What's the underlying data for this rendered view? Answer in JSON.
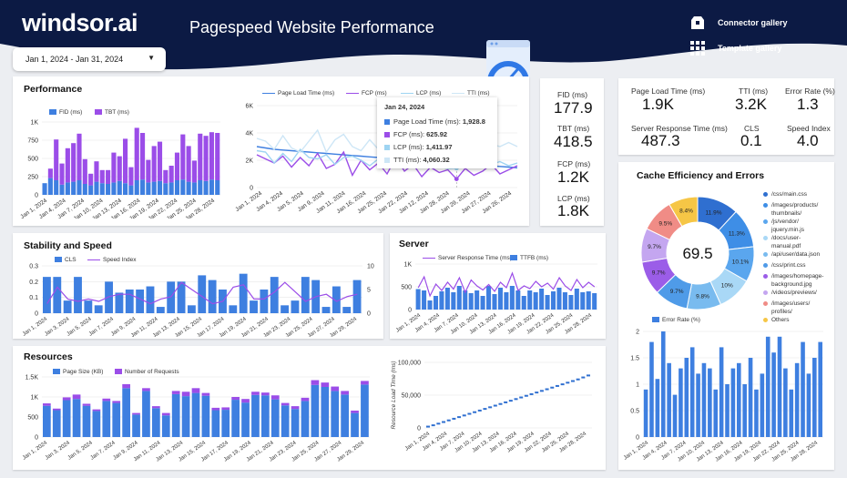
{
  "header": {
    "logo": "windsor.ai",
    "title": "Pagespeed Website Performance",
    "links": [
      {
        "label": "Connector gallery",
        "icon": "connector-icon"
      },
      {
        "label": "Template gallery",
        "icon": "grid-icon"
      }
    ]
  },
  "date_range": "Jan 1, 2024 - Jan 31, 2024",
  "colors": {
    "header": "#0c1a44",
    "blue": "#3e7fe0",
    "purple": "#9b4de8",
    "lightblue": "#9ed4f2",
    "darkblue": "#2f6fd0"
  },
  "scorecards_left": [
    {
      "label": "FID (ms)",
      "value": "177.9"
    },
    {
      "label": "TBT (ms)",
      "value": "418.5"
    },
    {
      "label": "FCP (ms)",
      "value": "1.2K"
    },
    {
      "label": "LCP (ms)",
      "value": "1.8K"
    }
  ],
  "scorecards_top": [
    {
      "label": "Page Load Time (ms)",
      "value": "1.9K"
    },
    {
      "label": "TTI (ms)",
      "value": "3.2K"
    },
    {
      "label": "Error Rate (%)",
      "value": "1.3"
    },
    {
      "label": "Server Response Time (ms)",
      "value": "487.3"
    },
    {
      "label": "CLS",
      "value": "0.1"
    },
    {
      "label": "Speed Index",
      "value": "4.0"
    }
  ],
  "sections": {
    "performance": "Performance",
    "stability": "Stability and Speed",
    "server": "Server",
    "resources": "Resources",
    "cache": "Cache Efficiency and Errors"
  },
  "tooltip": {
    "date": "Jan 24, 2024",
    "rows": [
      {
        "label": "Page Load Time (ms): ",
        "value": "1,928.8"
      },
      {
        "label": "FCP (ms): ",
        "value": "625.92"
      },
      {
        "label": "LCP (ms): ",
        "value": "1,411.97"
      },
      {
        "label": "TTI (ms): ",
        "value": "4,060.32"
      }
    ]
  },
  "chart_data": [
    {
      "id": "perf-bars",
      "type": "bar",
      "series": [
        {
          "name": "FID (ms)",
          "values": [
            160,
            230,
            200,
            140,
            170,
            180,
            200,
            150,
            130,
            180,
            160,
            150,
            170,
            190,
            160,
            130,
            200,
            210,
            170,
            180,
            190,
            160,
            170,
            200,
            210,
            180,
            170,
            200,
            190,
            210,
            200
          ]
        },
        {
          "name": "TBT (ms)",
          "values": [
            0,
            130,
            560,
            290,
            470,
            530,
            640,
            340,
            160,
            280,
            180,
            190,
            410,
            340,
            610,
            250,
            720,
            640,
            310,
            490,
            540,
            180,
            230,
            380,
            620,
            490,
            300,
            640,
            620,
            650,
            650
          ]
        }
      ],
      "x_ticks": [
        "Jan 1, 2024",
        "Jan 4, 2024",
        "Jan 7, 2024",
        "Jan 10, 2024",
        "Jan 13, 2024",
        "Jan 16, 2024",
        "Jan 19, 2024",
        "Jan 22, 2024",
        "Jan 25, 2024",
        "Jan 28, 2024"
      ],
      "y_ticks": [
        "0",
        "250",
        "500",
        "750",
        "1K"
      ],
      "ylim": [
        0,
        1000
      ]
    },
    {
      "id": "perf-lines",
      "type": "line",
      "series": [
        {
          "name": "Page Load Time (ms)",
          "values": [
            3000,
            2900,
            2800,
            2750,
            2700,
            2650,
            2600,
            2550,
            2500,
            2450,
            2400,
            2350,
            2300,
            2250,
            2200,
            2150,
            2100,
            2050,
            2000,
            1950,
            1928,
            1900,
            1850,
            1800,
            1750,
            1700,
            1650,
            1600,
            1550,
            1500,
            1450
          ]
        },
        {
          "name": "FCP (ms)",
          "values": [
            2400,
            2100,
            1800,
            2300,
            1500,
            2200,
            1600,
            2500,
            1400,
            1700,
            2600,
            900,
            2000,
            1300,
            1800,
            1000,
            2200,
            1200,
            1700,
            800,
            1500,
            1100,
            1300,
            626,
            1400,
            900,
            1200,
            1700,
            1000,
            1300,
            1600
          ]
        },
        {
          "name": "LCP (ms)",
          "values": [
            2700,
            2600,
            1800,
            2500,
            1900,
            2800,
            2200,
            2100,
            2400,
            1700,
            2200,
            2300,
            2000,
            1600,
            2100,
            2300,
            1500,
            2000,
            1900,
            1800,
            1700,
            1500,
            1400,
            1412,
            1900,
            1600,
            1800,
            1700,
            1900,
            1600,
            1800
          ]
        },
        {
          "name": "TTI (ms)",
          "values": [
            3600,
            3400,
            2800,
            3800,
            2900,
            2600,
            3400,
            4200,
            2600,
            3500,
            3900,
            3000,
            2700,
            3500,
            2800,
            3700,
            2500,
            3500,
            4300,
            2300,
            3400,
            3600,
            4500,
            4060,
            3200,
            2800,
            3500,
            3200,
            3000,
            3300,
            3000
          ]
        }
      ],
      "x_ticks": [
        "Jan 1, 2024",
        "Jan 4, 2024",
        "Jan 5, 2024",
        "Jan 9, 2024",
        "Jan 11, 2024",
        "Jan 16, 2024",
        "Jan 25, 2024",
        "Jan 22, 2024",
        "Jan 12, 2024",
        "Jan 28, 2024",
        "Jan 29, 2024",
        "Jan 27, 2024",
        "Jan 26, 2024"
      ],
      "y_ticks": [
        "0",
        "2K",
        "4K",
        "6K"
      ],
      "ylim": [
        0,
        6000
      ]
    },
    {
      "id": "stability",
      "type": "bar",
      "series": [
        {
          "name": "CLS",
          "values": [
            0.23,
            0.23,
            0.08,
            0.23,
            0.08,
            0.05,
            0.2,
            0.13,
            0.15,
            0.15,
            0.17,
            0.04,
            0.2,
            0.2,
            0.05,
            0.24,
            0.21,
            0.15,
            0.05,
            0.25,
            0.08,
            0.15,
            0.23,
            0.05,
            0.08,
            0.23,
            0.21,
            0.04,
            0.17,
            0.04,
            0.21
          ]
        },
        {
          "name": "Speed Index",
          "values": [
            2.0,
            5.5,
            3.0,
            2.5,
            3.0,
            2.5,
            3.5,
            4.0,
            4.0,
            3.0,
            2.0,
            3.0,
            3.5,
            6.5,
            5.0,
            3.5,
            2.0,
            2.5,
            5.5,
            6.0,
            3.0,
            3.0,
            4.5,
            6.5,
            4.5,
            2.5,
            3.5,
            4.0,
            2.5,
            3.5,
            4.0
          ]
        }
      ],
      "x_ticks": [
        "Jan 1, 2024",
        "Jan 3, 2024",
        "Jan 5, 2024",
        "Jan 7, 2024",
        "Jan 9, 2024",
        "Jan 11, 2024",
        "Jan 13, 2024",
        "Jan 15, 2024",
        "Jan 17, 2024",
        "Jan 19, 2024",
        "Jan 21, 2024",
        "Jan 23, 2024",
        "Jan 25, 2024",
        "Jan 27, 2024",
        "Jan 29, 2024"
      ],
      "y_ticks": [
        "0",
        "0.1",
        "0.2",
        "0.3"
      ],
      "y2_ticks": [
        "0",
        "5",
        "10"
      ],
      "ylim": [
        0,
        0.3
      ],
      "y2lim": [
        0,
        10
      ]
    },
    {
      "id": "server",
      "type": "bar",
      "series": [
        {
          "name": "Server Response Time (ms)",
          "values": [
            480,
            720,
            300,
            560,
            420,
            600,
            450,
            700,
            380,
            650,
            520,
            430,
            550,
            400,
            600,
            480,
            800,
            420,
            520,
            460,
            620,
            500,
            580,
            450,
            700,
            520,
            420,
            660,
            480,
            600,
            500
          ]
        },
        {
          "name": "TTFB (ms)",
          "values": [
            450,
            420,
            200,
            300,
            400,
            480,
            380,
            520,
            420,
            360,
            420,
            300,
            520,
            340,
            480,
            380,
            520,
            420,
            300,
            420,
            380,
            460,
            320,
            400,
            480,
            380,
            320,
            460,
            380,
            400,
            360
          ]
        }
      ],
      "x_ticks": [
        "Jan 1, 2024",
        "Jan 4, 2024",
        "Jan 7, 2024",
        "Jan 10, 2024",
        "Jan 13, 2024",
        "Jan 16, 2024",
        "Jan 19, 2024",
        "Jan 22, 2024",
        "Jan 25, 2024",
        "Jan 28, 2024"
      ],
      "y_ticks": [
        "0",
        "500",
        "1K"
      ],
      "ylim": [
        0,
        1000
      ]
    },
    {
      "id": "resources",
      "type": "bar",
      "series": [
        {
          "name": "Page Size (KB)",
          "values": [
            780,
            670,
            920,
            950,
            780,
            650,
            900,
            850,
            1220,
            560,
            1150,
            720,
            540,
            1070,
            1020,
            1100,
            1030,
            670,
            680,
            930,
            860,
            1050,
            1040,
            940,
            790,
            700,
            900,
            1300,
            1250,
            1150,
            1060,
            600,
            1310
          ]
        },
        {
          "name": "Number of Requests",
          "values": [
            60,
            40,
            70,
            110,
            50,
            40,
            60,
            50,
            100,
            40,
            70,
            50,
            60,
            80,
            110,
            120,
            70,
            60,
            60,
            70,
            90,
            80,
            70,
            100,
            60,
            70,
            80,
            120,
            110,
            110,
            90,
            60,
            90
          ]
        }
      ],
      "x_ticks": [
        "Jan 1, 2024",
        "Jan 3, 2024",
        "Jan 5, 2024",
        "Jan 7, 2024",
        "Jan 9, 2024",
        "Jan 11, 2024",
        "Jan 13, 2024",
        "Jan 15, 2024",
        "Jan 17, 2024",
        "Jan 19, 2024",
        "Jan 21, 2024",
        "Jan 23, 2024",
        "Jan 25, 2024",
        "Jan 27, 2024",
        "Jan 29, 2024"
      ],
      "y_ticks": [
        "0",
        "500",
        "1K",
        "1.5K"
      ],
      "ylim": [
        0,
        1500
      ]
    },
    {
      "id": "resource-load",
      "type": "scatter",
      "ylabel": "Resource Load Time (ms)",
      "values": [
        2000,
        4000,
        6500,
        9000,
        11500,
        14000,
        16500,
        19000,
        21500,
        24000,
        26500,
        29000,
        31500,
        34000,
        36500,
        39000,
        41500,
        44000,
        46500,
        49000,
        51500,
        54000,
        56500,
        59000,
        61500,
        64000,
        66500,
        69000,
        71500,
        74000,
        77000,
        80000
      ],
      "x_ticks": [
        "Jan 1, 2024",
        "Jan 4, 2024",
        "Jan 7, 2024",
        "Jan 10, 2024",
        "Jan 13, 2024",
        "Jan 16, 2024",
        "Jan 19, 2024",
        "Jan 22, 2024",
        "Jan 25, 2024",
        "Jan 28, 2024"
      ],
      "y_ticks": [
        "0",
        "50,000",
        "100,000"
      ],
      "ylim": [
        0,
        100000
      ]
    },
    {
      "id": "cache-donut",
      "type": "pie",
      "center_label": "69.5",
      "slices": [
        {
          "label": "/css/main.css",
          "value": 11.9,
          "color": "#2f6fd0"
        },
        {
          "label": "/images/products/thumbnails/",
          "value": 11.3,
          "color": "#3e8ee6"
        },
        {
          "label": "/js/vendor/jquery.min.js",
          "value": 10.1,
          "color": "#5aa6ee"
        },
        {
          "label": "/docs/user-manual.pdf",
          "value": 10,
          "color": "#a9d8f6"
        },
        {
          "label": "/api/user/data.json",
          "value": 9.8,
          "color": "#79bbef"
        },
        {
          "label": "/css/print.css",
          "value": 9.7,
          "color": "#4f9be8"
        },
        {
          "label": "/images/homepage-background.jpg",
          "value": 9.7,
          "color": "#9b5de8"
        },
        {
          "label": "/videos/previews/",
          "value": 9.7,
          "color": "#c4a6f0"
        },
        {
          "label": "/images/users/profiles/",
          "value": 9.5,
          "color": "#f08c86"
        },
        {
          "label": "Others",
          "value": 8.4,
          "color": "#f6c646"
        }
      ],
      "slice_labels": [
        "11.9%",
        "11.3%",
        "10.1%",
        "10%",
        "9.8%",
        "9.7%",
        "9.7%",
        "9.7%",
        "9.5%",
        "8.4%"
      ]
    },
    {
      "id": "error-rate",
      "type": "bar",
      "series": [
        {
          "name": "Error Rate (%)",
          "values": [
            0.9,
            1.8,
            1.1,
            2.0,
            1.4,
            0.8,
            1.3,
            1.5,
            1.7,
            1.2,
            1.4,
            1.3,
            0.9,
            1.7,
            1.0,
            1.3,
            1.4,
            1.0,
            1.5,
            0.9,
            1.2,
            1.9,
            1.6,
            1.9,
            1.3,
            0.9,
            1.4,
            1.8,
            1.2,
            1.5,
            1.8
          ]
        }
      ],
      "x_ticks": [
        "Jan 1, 2024",
        "Jan 4, 2024",
        "Jan 7, 2024",
        "Jan 10, 2024",
        "Jan 13, 2024",
        "Jan 16, 2024",
        "Jan 19, 2024",
        "Jan 22, 2024",
        "Jan 25, 2024",
        "Jan 28, 2024"
      ],
      "y_ticks": [
        "0",
        "0.5",
        "1",
        "1.5",
        "2"
      ],
      "ylim": [
        0,
        2
      ]
    }
  ]
}
